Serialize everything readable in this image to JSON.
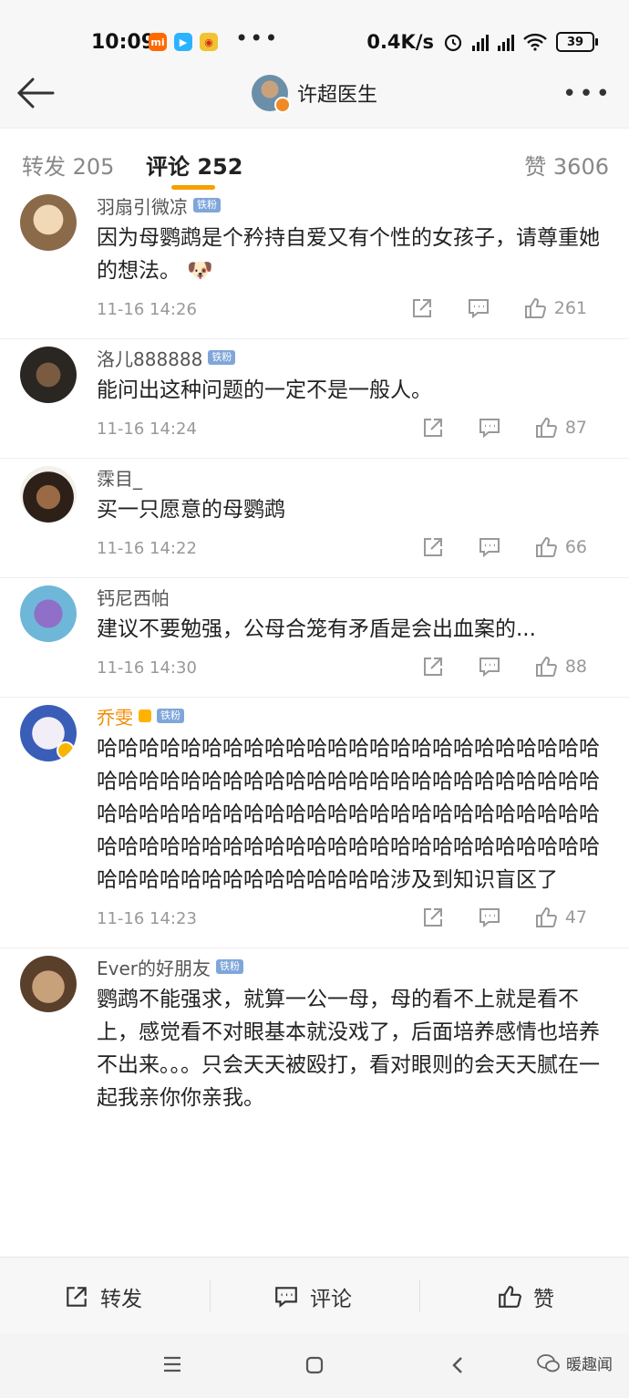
{
  "status": {
    "time": "10:09",
    "net_speed": "0.4K/s",
    "battery": "39"
  },
  "header": {
    "title": "许超医生"
  },
  "tabs": [
    {
      "label": "转发 205"
    },
    {
      "label": "评论 252"
    },
    {
      "label": "赞 3606"
    }
  ],
  "comments": [
    {
      "user": "羽扇引微凉",
      "badge": "铁粉",
      "text": "因为母鹦鹉是个矜持自爱又有个性的女孩子，请尊重她的想法。",
      "emoji": "🐶",
      "time": "11-16 14:26",
      "likes": "261"
    },
    {
      "user": "洛儿888888",
      "badge": "铁粉",
      "text": "能问出这种问题的一定不是一般人。",
      "time": "11-16 14:24",
      "likes": "87"
    },
    {
      "user": "霂目_",
      "badge": "",
      "text": "买一只愿意的母鹦鹉",
      "time": "11-16 14:22",
      "likes": "66"
    },
    {
      "user": "钙尼西帕",
      "badge": "",
      "text": "建议不要勉强，公母合笼有矛盾是会出血案的...",
      "time": "11-16 14:30",
      "likes": "88"
    },
    {
      "user": "乔雯",
      "badge": "铁粉",
      "text": "哈哈哈哈哈哈哈哈哈哈哈哈哈哈哈哈哈哈哈哈哈哈哈哈哈哈哈哈哈哈哈哈哈哈哈哈哈哈哈哈哈哈哈哈哈哈哈哈哈哈哈哈哈哈哈哈哈哈哈哈哈哈哈哈哈哈哈哈哈哈哈哈哈哈哈哈哈哈哈哈哈哈哈哈哈哈哈哈哈哈哈哈哈哈哈哈哈哈哈哈哈哈哈哈哈哈哈哈哈哈涉及到知识盲区了",
      "time": "11-16 14:23",
      "likes": "47"
    },
    {
      "user": "Ever的好朋友",
      "badge": "铁粉",
      "text": "鹦鹉不能强求，就算一公一母，母的看不上就是看不上，感觉看不对眼基本就没戏了，后面培养感情也培养不出来。。。只会天天被殴打，看对眼则的会天天腻在一起我亲你你亲我。",
      "time": "",
      "likes": ""
    }
  ],
  "bottom_bar": {
    "repost": "转发",
    "comment": "评论",
    "like": "赞"
  },
  "watermark": "暖趣闻",
  "colors": {
    "accent": "#f7a000",
    "badge": "#7fa6d9",
    "gold_name": "#f08a00"
  }
}
